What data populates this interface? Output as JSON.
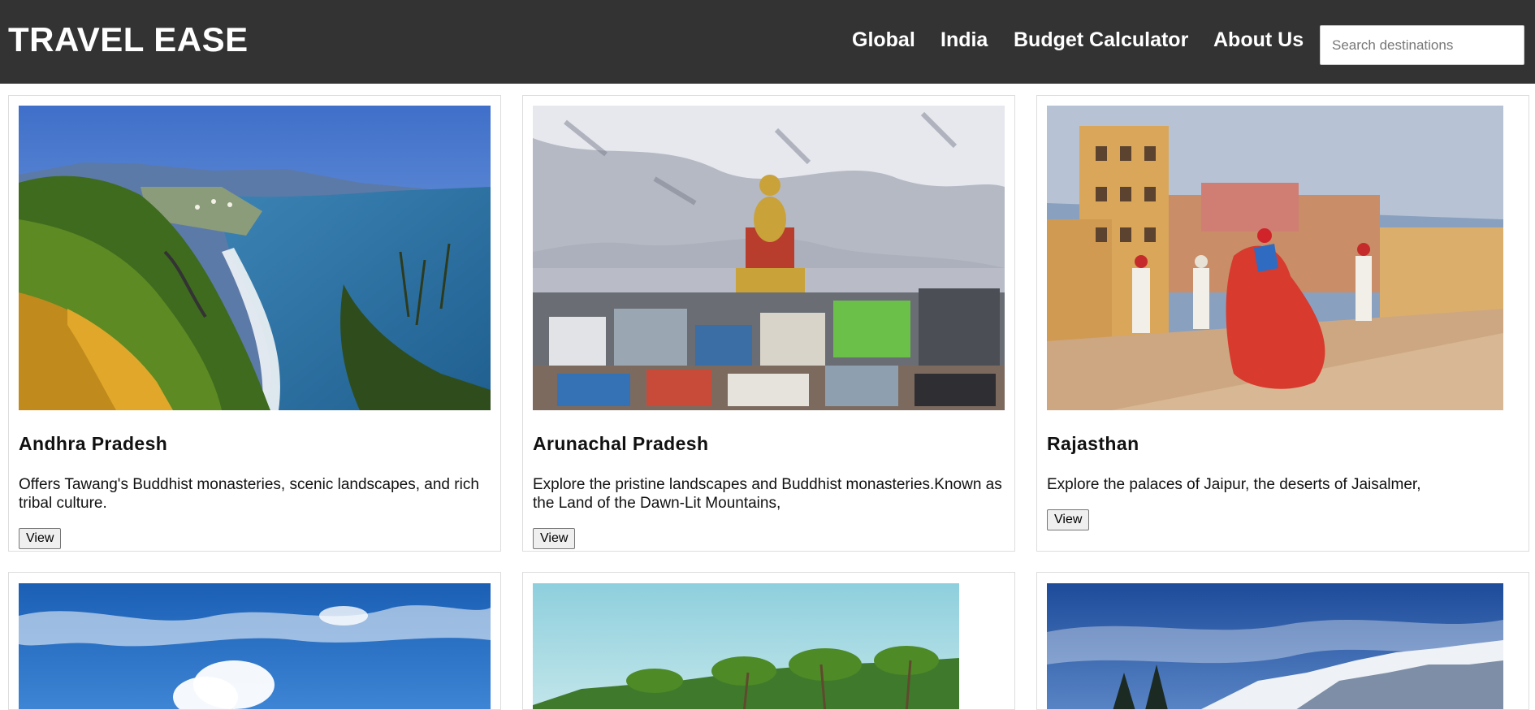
{
  "header": {
    "brand": "TRAVEL EASE",
    "nav": [
      {
        "label": "Global"
      },
      {
        "label": "India"
      },
      {
        "label": "Budget Calculator"
      },
      {
        "label": "About Us"
      }
    ],
    "search": {
      "placeholder": "Search destinations",
      "value": ""
    }
  },
  "destinations": [
    {
      "title": "Andhra Pradesh",
      "description": "Offers Tawang's Buddhist monasteries, scenic landscapes, and rich tribal culture.",
      "button": "View"
    },
    {
      "title": "Arunachal Pradesh",
      "description": "Explore the pristine landscapes and Buddhist monasteries.Known as the Land of the Dawn-Lit Mountains,",
      "button": "View"
    },
    {
      "title": "Rajasthan",
      "description": "Explore the palaces of Jaipur, the deserts of Jaisalmer,",
      "button": "View"
    }
  ],
  "colors": {
    "header_bg": "#333333",
    "header_text": "#ffffff",
    "card_border": "#dddddd",
    "button_bg": "#efefef"
  },
  "icons": {
    "photo_1": "coastal-hills-photo",
    "photo_2": "buddha-statue-town-photo",
    "photo_3": "palace-dancers-photo",
    "photo_4": "blue-sky-clouds-photo",
    "photo_5": "palm-trees-photo",
    "photo_6": "snowy-mountains-photo"
  }
}
